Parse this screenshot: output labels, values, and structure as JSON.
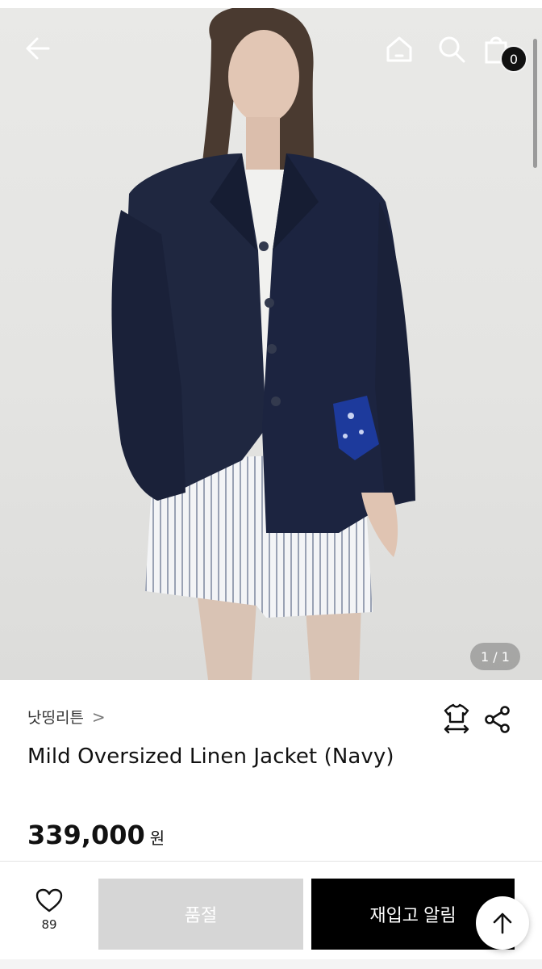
{
  "header": {
    "icons": [
      "back-arrow-icon",
      "home-icon",
      "search-icon",
      "shopping-bag-icon"
    ],
    "cart_count": "0"
  },
  "gallery": {
    "pager": "1 / 1"
  },
  "product": {
    "brand": "낫띵리튼",
    "brand_chevron": ">",
    "title": "Mild Oversized Linen Jacket (Navy)",
    "price": "339,000",
    "currency": "원"
  },
  "actions": {
    "like_count": "89",
    "soldout_label": "품절",
    "restock_label": "재입고 알림"
  },
  "colors": {
    "primary_button": "#000000",
    "disabled_button": "#d6d6d6",
    "jacket_navy": "#1f2740"
  }
}
